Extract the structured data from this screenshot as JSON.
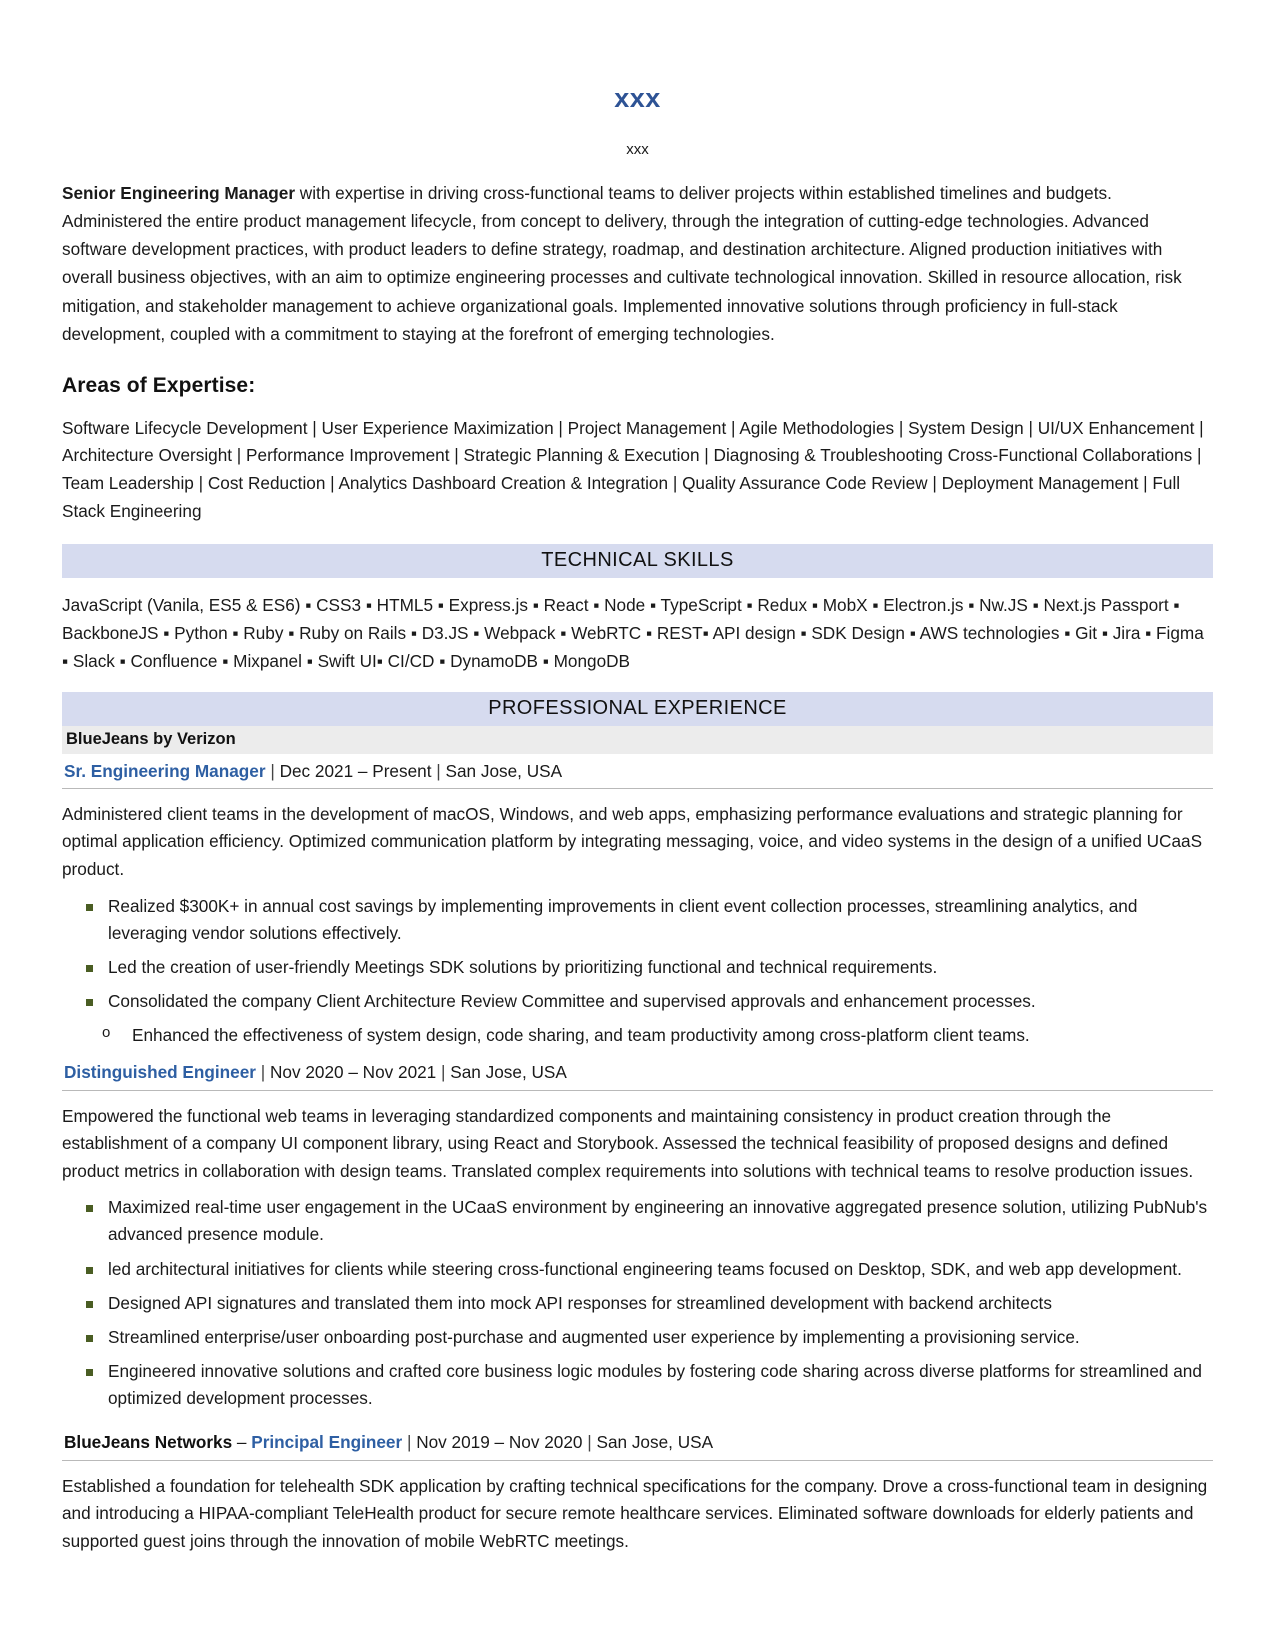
{
  "header": {
    "name": "xxx",
    "contact": "xxx",
    "name_color": "#2e5395"
  },
  "summary": {
    "lead": "Senior Engineering Manager",
    "body": " with expertise in driving cross-functional teams to deliver projects within established timelines and budgets. Administered the entire product management lifecycle, from concept to delivery, through the integration of cutting-edge technologies. Advanced software development practices, with product leaders to define strategy, roadmap, and destination architecture. Aligned production initiatives with overall business objectives, with an aim to optimize engineering processes and cultivate technological innovation. Skilled in resource allocation, risk mitigation, and stakeholder management to achieve organizational goals. Implemented innovative solutions through proficiency in full-stack development, coupled with a commitment to staying at the forefront of emerging technologies."
  },
  "expertise": {
    "title": "Areas of Expertise:",
    "text": "Software Lifecycle Development | User Experience Maximization | Project Management | Agile Methodologies | System Design | UI/UX Enhancement | Architecture Oversight | Performance Improvement | Strategic Planning & Execution | Diagnosing & Troubleshooting Cross-Functional Collaborations | Team Leadership | Cost Reduction | Analytics Dashboard Creation & Integration | Quality Assurance Code Review | Deployment Management | Full Stack Engineering"
  },
  "technical_skills": {
    "band_label": "TECHNICAL SKILLS",
    "text": "JavaScript (Vanila, ES5 & ES6) ▪ CSS3 ▪ HTML5 ▪ Express.js ▪ React ▪ Node ▪ TypeScript ▪ Redux ▪ MobX ▪ Electron.js ▪ Nw.JS ▪ Next.js Passport ▪ BackboneJS ▪ Python ▪ Ruby ▪ Ruby on Rails ▪ D3.JS ▪ Webpack ▪ WebRTC ▪ REST▪ API design ▪ SDK Design ▪ AWS technologies ▪ Git ▪ Jira ▪ Figma ▪ Slack ▪ Confluence ▪ Mixpanel ▪ Swift UI▪ CI/CD ▪ DynamoDB ▪ MongoDB"
  },
  "experience": {
    "band_label": "PROFESSIONAL EXPERIENCE",
    "company": "BlueJeans by Verizon",
    "jobs": [
      {
        "title": "Sr. Engineering Manager",
        "dates": "Dec 2021 – Present",
        "location": "San Jose, USA",
        "description": "Administered client teams in the development of macOS, Windows, and web apps, emphasizing performance evaluations and strategic planning for optimal application efficiency. Optimized communication platform by integrating messaging, voice, and video systems in the design of a unified UCaaS product.",
        "bullets": [
          "Realized $300K+ in annual cost savings by implementing improvements in client event collection processes, streamlining analytics, and leveraging vendor solutions effectively.",
          "Led the creation of user-friendly Meetings SDK solutions by prioritizing functional and technical requirements.",
          "Consolidated the company Client Architecture Review Committee and supervised approvals and enhancement processes."
        ],
        "subbullet": "Enhanced the effectiveness of system design, code sharing, and team productivity among cross-platform client teams."
      },
      {
        "title": "Distinguished Engineer",
        "dates": "Nov 2020 – Nov 2021",
        "location": "San Jose, USA",
        "description": "Empowered the functional web teams in leveraging standardized components and maintaining consistency in product creation through the establishment of a company UI component library, using React and Storybook. Assessed the technical feasibility of proposed designs and defined product metrics in collaboration with design teams. Translated complex requirements into solutions with technical teams to resolve production issues.",
        "bullets": [
          "Maximized real-time user engagement in the UCaaS environment by engineering an innovative aggregated presence solution, utilizing PubNub's advanced presence module.",
          "led architectural initiatives for clients while steering cross-functional engineering teams focused on Desktop, SDK, and web app development.",
          "Designed API signatures and translated them into mock API responses for streamlined development with backend architects",
          "Streamlined enterprise/user onboarding post-purchase and augmented user experience by implementing a provisioning service.",
          "Engineered innovative solutions and crafted core business logic modules by fostering code sharing across diverse platforms for streamlined and optimized development processes."
        ]
      },
      {
        "company_inline": "BlueJeans Networks",
        "dash": " – ",
        "title": "Principal Engineer",
        "dates": "Nov 2019 – Nov 2020",
        "location": "San Jose, USA",
        "description": "Established a foundation for telehealth SDK application by crafting technical specifications for the company. Drove a cross-functional team in designing and introducing a HIPAA-compliant TeleHealth product for secure remote healthcare services. Eliminated software downloads for elderly patients and supported guest joins through the innovation of mobile WebRTC meetings.",
        "bullets": []
      }
    ],
    "separator": "|"
  },
  "theme": {
    "band_bg": "#d6dbef",
    "company_band_bg": "#ececec",
    "title_blue": "#2e5fa3",
    "bullet_green": "#4a5d23"
  }
}
